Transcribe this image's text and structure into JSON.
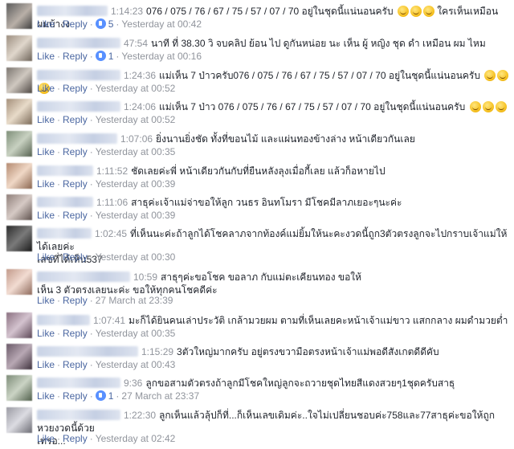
{
  "labels": {
    "like": "Like",
    "reply": "Reply",
    "dot": "·"
  },
  "colors": {
    "link": "#4b67a1",
    "meta": "#90949c",
    "text": "#1d2129",
    "reaction": "#5890ff"
  },
  "comments": [
    {
      "timestamp": "1:14:23",
      "text": "076 / 075 / 76 / 67 / 75 / 57 / 07 / 70 อยู่ในชุดนี้แน่นอนครับ",
      "emoji_count": 3,
      "trailing_text": "ใครเห็นเหมือนผมบ้างง",
      "reactions": "5",
      "date": "Yesterday at 00:42"
    },
    {
      "timestamp": "47:54",
      "text": "นาที ที่ 38.30 วิ จบคลิป ย้อน ไป ดูกันหน่อย นะ เห็น ผู้ หญิง ชุด ดำ เหมือน ผม ไหม",
      "emoji_count": 0,
      "trailing_text": "",
      "reactions": "1",
      "date": "Yesterday at 00:16"
    },
    {
      "timestamp": "1:24:36",
      "text": "แม่เห็น 7 ป่าวครับ076 / 075 / 76 / 67 / 75 / 57 / 07 / 70 อยู่ในชุดนี้แน่นอนครับ",
      "emoji_count": 3,
      "trailing_text": "",
      "reactions": "",
      "date": "Yesterday at 00:52"
    },
    {
      "timestamp": "1:24:06",
      "text": "แม่เห็น 7 ป่าว 076 / 075 / 76 / 67 / 75 / 57 / 07 / 70 อยู่ในชุดนี้แน่นอนครับ",
      "emoji_count": 3,
      "trailing_text": "",
      "reactions": "",
      "date": "Yesterday at 00:52"
    },
    {
      "timestamp": "1:07:06",
      "text": "ยิ่งนานยิ่งชัด ทั้งที่ขอนไม้ และแผ่นทองข้างล่าง หน้าเดียวกันเลย",
      "emoji_count": 0,
      "trailing_text": "",
      "reactions": "",
      "date": "Yesterday at 00:35"
    },
    {
      "timestamp": "1:11:52",
      "text": "ชัดเลยค่ะพี่ หน้าเดียวกันกับที่ยืนหลังลุงเมื่อกี้เลย แล้วก็อหายไป",
      "emoji_count": 0,
      "trailing_text": "",
      "reactions": "",
      "date": "Yesterday at 00:39"
    },
    {
      "timestamp": "1:11:06",
      "text": "สาธุค่ะเจ้าแม่จ่าขอให้ลูก วนธร อินทโมรา มีโชคมีลาภเยอะๆนะค่ะ",
      "emoji_count": 0,
      "trailing_text": "",
      "reactions": "",
      "date": "Yesterday at 00:39"
    },
    {
      "timestamp": "1:02:45",
      "text": "ที่เห็นนะค่ะถ้าลูกได้โชคลาภจากท้องค์แม่ยิ้มให้นะคะงวดนี้ถูก3ตัวตรงลูกจะไปกราบเจ้าแม่ให้ได้เลยค่ะ",
      "line2": "เลขที่ได้เห็น537",
      "emoji_count": 0,
      "trailing_text": "",
      "reactions": "",
      "date": "Yesterday at 00:30"
    },
    {
      "timestamp": "10:59",
      "text": "สาธุๆค่ะขอโชค ขอลาภ กับแม่ตะเคียนทอง ขอให้",
      "line2": "เห็น 3 ตัวตรงเลยนะค่ะ ขอให้ทุกคนโชคดีค่ะ",
      "emoji_count": 0,
      "trailing_text": "",
      "reactions": "",
      "date": "27 March at 23:39"
    },
    {
      "timestamp": "1:07:41",
      "text": "มะก็ได้ยินคนเล่าประวัติ เกล้ามวยผม ตามที่เห็นเลยคะหน้าเจ้าแม่ขาว แสกกลาง ผมดำมวยต่ำ",
      "emoji_count": 0,
      "trailing_text": "",
      "reactions": "",
      "date": "Yesterday at 00:35"
    },
    {
      "timestamp": "1:15:29",
      "text": "3ตัวใหญ่มากครับ อยู่ตรงขวามือตรงหน้าเจ้าแม่พอดีสังเกตดีดีคับ",
      "emoji_count": 0,
      "trailing_text": "",
      "reactions": "",
      "date": "Yesterday at 00:43"
    },
    {
      "timestamp": "9:36",
      "text": "ลูกขอสามตัวตรงถ้าลูกมีโชคใหญ่ลูกจะถวายชุดไทยสีแดงสวยๆ1ชุดครับสาธุ",
      "emoji_count": 0,
      "trailing_text": "",
      "reactions": "1",
      "date": "27 March at 23:37"
    },
    {
      "timestamp": "1:22:30",
      "text": "ลูกเห็นแล้วลุ้ปก็ที่...ก็เห็นเลขเดิมค่ะ..ใจไม่เปลี่ยนชอบค่ะ758และ77สาธุค่ะขอให้ถูกหวยงวดนี้ด้วย",
      "line2": "เทรอ...",
      "emoji_count": 0,
      "trailing_text": "",
      "reactions": "",
      "date": "Yesterday at 02:42"
    }
  ]
}
